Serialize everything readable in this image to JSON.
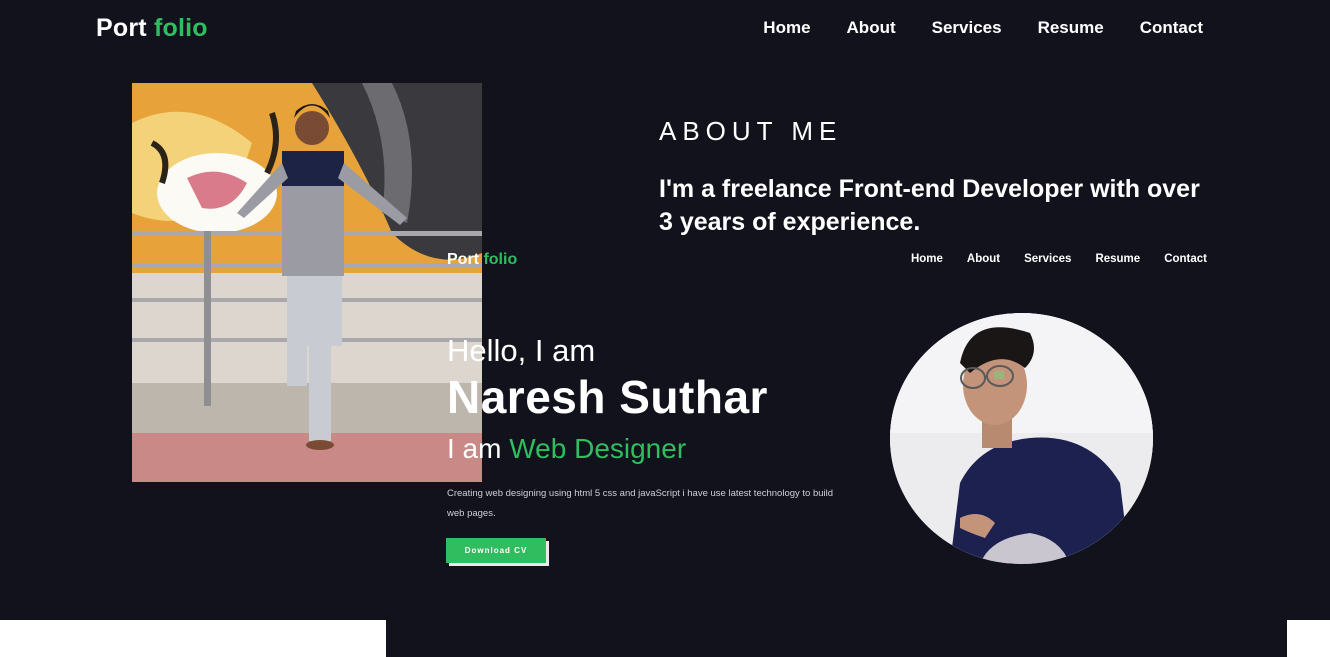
{
  "header": {
    "logo_main": "Port",
    "logo_accent": "folio",
    "nav": [
      "Home",
      "About",
      "Services",
      "Resume",
      "Contact"
    ]
  },
  "about": {
    "title": "ABOUT ME",
    "description": "I'm a freelance Front-end Developer with over 3 years of experience."
  },
  "preview": {
    "logo_main": "Port",
    "logo_accent": "folio",
    "nav": [
      "Home",
      "About",
      "Services",
      "Resume",
      "Contact"
    ],
    "hello": "Hello, I am",
    "name": "Naresh Suthar",
    "role_prefix": "I am",
    "role_accent": "Web Designer",
    "description": "Creating web designing using html 5 css and javaScript i have use latest technology to build web pages.",
    "cv_button": "Download CV"
  },
  "colors": {
    "background": "#12121c",
    "accent": "#2fbd5f",
    "text": "#ffffff"
  }
}
